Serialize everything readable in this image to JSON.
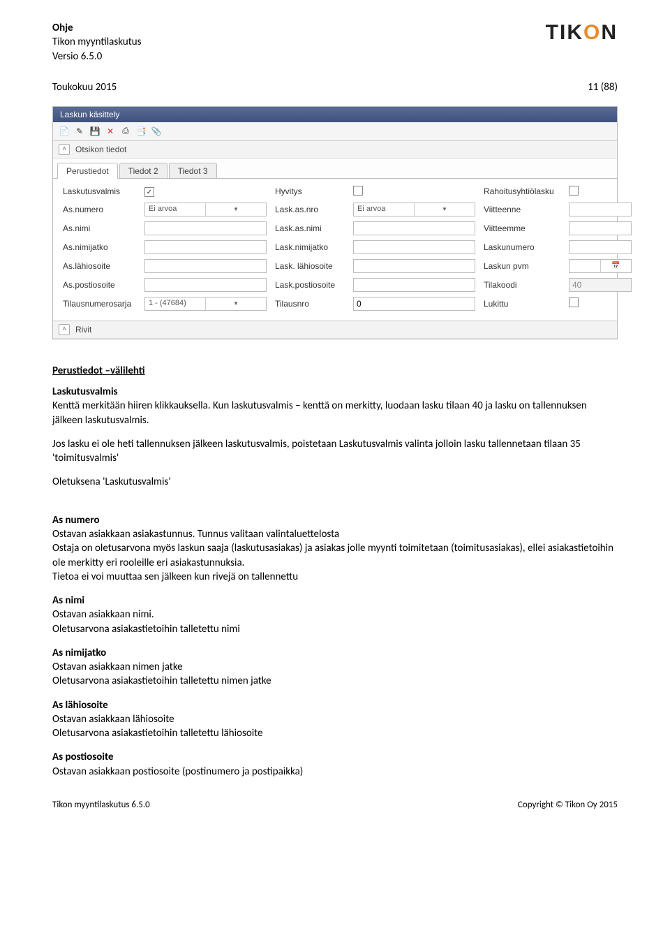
{
  "header": {
    "title_guide": "Ohje",
    "title_product": "Tikon myyntilaskutus",
    "title_version": "Versio 6.5.0",
    "logo": {
      "t": "T",
      "i": "I",
      "k": "K",
      "o": "O",
      "n": "N"
    }
  },
  "date_page": {
    "date": "Toukokuu 2015",
    "page": "11 (88)"
  },
  "screenshot": {
    "window_title": "Laskun käsittely",
    "section_otsikon": "Otsikon tiedot",
    "section_rivit": "Rivit",
    "tabs": {
      "t1": "Perustiedot",
      "t2": "Tiedot 2",
      "t3": "Tiedot 3"
    },
    "labels": {
      "laskutusvalmis": "Laskutusvalmis",
      "hyvitys": "Hyvitys",
      "rahoitus": "Rahoitusyhtiölasku",
      "as_numero": "As.numero",
      "lask_as_nro": "Lask.as.nro",
      "viitteenne": "Viitteenne",
      "as_nimi": "As.nimi",
      "lask_as_nimi": "Lask.as.nimi",
      "viitteemme": "Viitteemme",
      "as_nimijatko": "As.nimijatko",
      "lask_nimijatko": "Lask.nimijatko",
      "laskunumero": "Laskunumero",
      "as_lahiosoite": "As.lähiosoite",
      "lask_lahiosoite": "Lask. lähiosoite",
      "laskun_pvm": "Laskun pvm",
      "as_postiosoite": "As.postiosoite",
      "lask_postiosoite": "Lask.postiosoite",
      "tilakoodi": "Tilakoodi",
      "tilausnumerosarja": "Tilausnumerosarja",
      "tilausnro": "Tilausnro",
      "lukittu": "Lukittu"
    },
    "values": {
      "ei_arvoa": "Ei arvoa",
      "tilausnumerosarja": "1 - (47684)",
      "tilausnro": "0",
      "tilakoodi": "40",
      "laskutusvalmis_checked": "✓"
    }
  },
  "body": {
    "section_head": "Perustiedot –välilehti",
    "p1_label": "Laskutusvalmis",
    "p1_a": "Kenttä merkitään hiiren klikkauksella. Kun laskutusvalmis – kenttä on merkitty, luodaan lasku tilaan 40 ja lasku on tallennuksen jälkeen laskutusvalmis.",
    "p1_b": "Jos lasku ei ole heti tallennuksen jälkeen laskutusvalmis, poistetaan Laskutusvalmis valinta jolloin lasku tallennetaan tilaan 35 'toimitusvalmis'",
    "p1_c": "Oletuksena 'Laskutusvalmis'",
    "p2_label": "As numero",
    "p2_a": "Ostavan asiakkaan asiakastunnus. Tunnus valitaan valintaluettelosta",
    "p2_b": "Ostaja on oletusarvona myös laskun saaja (laskutusasiakas) ja asiakas jolle myynti toimitetaan (toimitusasiakas), ellei asiakastietoihin ole merkitty eri rooleille eri asiakastunnuksia.",
    "p2_c": "Tietoa ei voi muuttaa sen jälkeen kun rivejä on tallennettu",
    "p3_label": "As nimi",
    "p3_a": "Ostavan asiakkaan nimi.",
    "p3_b": "Oletusarvona asiakastietoihin talletettu nimi",
    "p4_label": "As nimijatko",
    "p4_a": "Ostavan asiakkaan nimen jatke",
    "p4_b": "Oletusarvona asiakastietoihin talletettu nimen jatke",
    "p5_label": "As lähiosoite",
    "p5_a": "Ostavan asiakkaan lähiosoite",
    "p5_b": "Oletusarvona asiakastietoihin talletettu lähiosoite",
    "p6_label": "As postiosoite",
    "p6_a": "Ostavan asiakkaan postiosoite (postinumero ja postipaikka)"
  },
  "footer": {
    "left": "Tikon myyntilaskutus 6.5.0",
    "right": "Copyright © Tikon Oy 2015"
  }
}
